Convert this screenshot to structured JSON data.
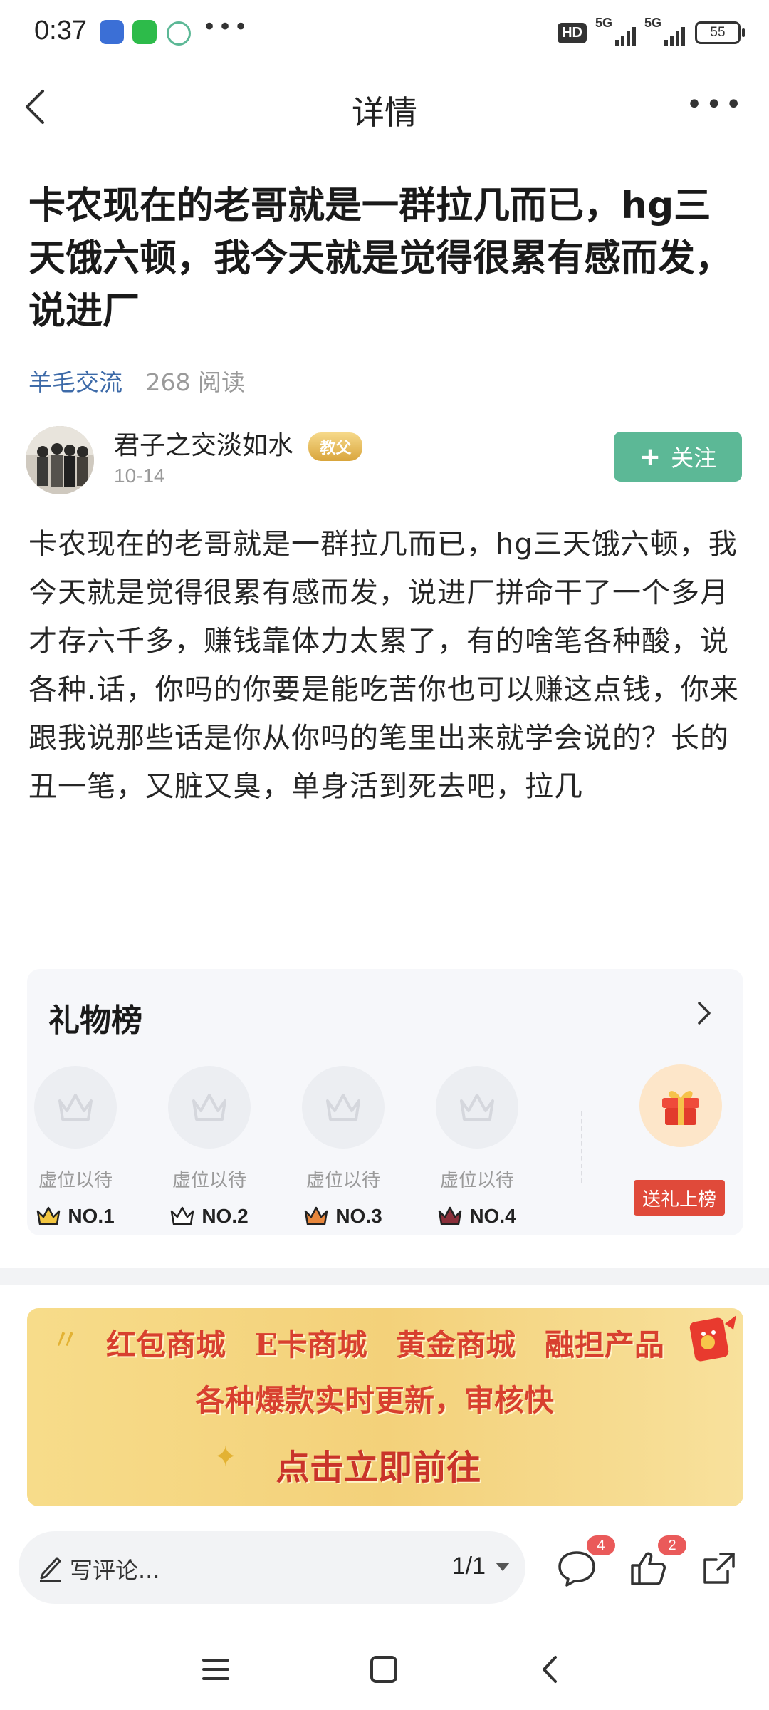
{
  "status_bar": {
    "time": "0:37",
    "hd": "HD",
    "net1": "5G",
    "net2": "5G",
    "battery": "55"
  },
  "nav": {
    "title": "详情"
  },
  "post": {
    "headline": "卡农现在的老哥就是一群拉几而已，hg三天饿六顿，我今天就是觉得很累有感而发，说进厂",
    "category": "羊毛交流",
    "reads": "268 阅读",
    "author": {
      "name": "君子之交淡如水",
      "badge": "教父",
      "date": "10-14"
    },
    "follow_label": "关注",
    "body": "卡农现在的老哥就是一群拉几而已，hg三天饿六顿，我今天就是觉得很累有感而发，说进厂拼命干了一个多月才存六千多，赚钱靠体力太累了，有的啥笔各种酸，说各种.话，你吗的你要是能吃苦你也可以赚这点钱，你来跟我说那些话是你从你吗的笔里出来就学会说的？长的丑一笔，又脏又臭，单身活到死去吧，拉几"
  },
  "gift_board": {
    "title": "礼物榜",
    "slots": [
      {
        "label": "虚位以待",
        "rank": "NO.1",
        "color": "#e6a92a"
      },
      {
        "label": "虚位以待",
        "rank": "NO.2",
        "color": "#5a5a5a"
      },
      {
        "label": "虚位以待",
        "rank": "NO.3",
        "color": "#d9792f"
      },
      {
        "label": "虚位以待",
        "rank": "NO.4",
        "color": "#8a2f3a"
      }
    ],
    "send_label": "送礼上榜"
  },
  "banner": {
    "line1": "红包商城 E卡商城 黄金商城 融担产品",
    "line2": "各种爆款实时更新，审核快",
    "line3": "点击立即前往"
  },
  "bottom_bar": {
    "comment_placeholder": "写评论...",
    "page_indicator": "1/1",
    "comment_count": "4",
    "like_count": "2"
  },
  "colors": {
    "accent_green": "#5cb896",
    "link_blue": "#3d6aa8",
    "banner_red": "#d8402f"
  }
}
